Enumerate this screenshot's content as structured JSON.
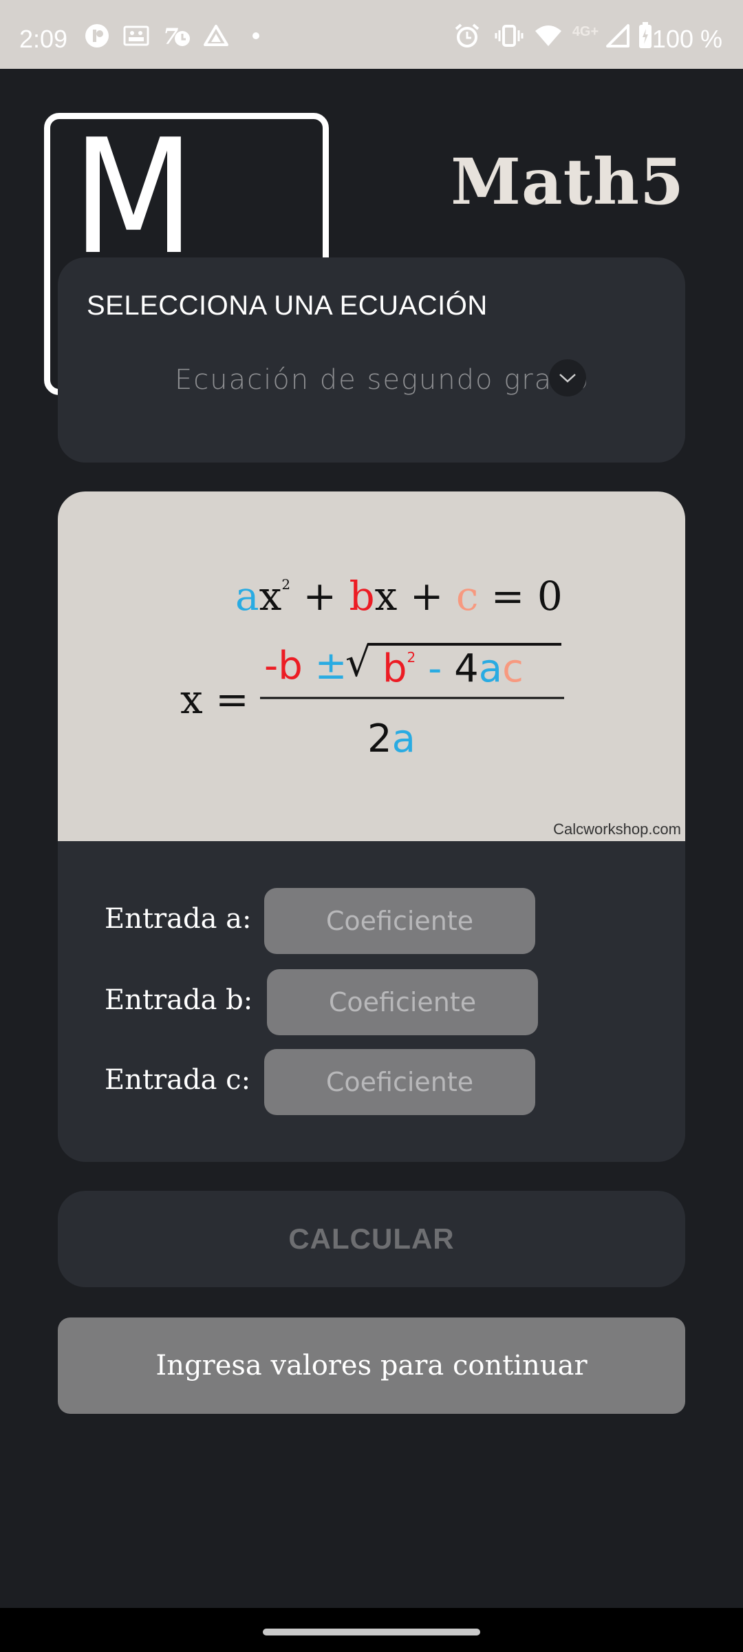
{
  "status_bar": {
    "time": "2:09",
    "network": "4G+",
    "battery": "100 %",
    "icons": [
      "app-icon-p",
      "gallery-icon",
      "lock-app-icon",
      "drive-icon",
      "dot-icon",
      "alarm-icon",
      "vibrate-icon",
      "wifi-icon",
      "signal-icon",
      "battery-charging-icon"
    ]
  },
  "app": {
    "logo_letter": "M",
    "title": "Math5"
  },
  "equation_select": {
    "heading": "SELECCIONA UNA ECUACIÓN",
    "value": "Ecuación de segundo grado"
  },
  "formula": {
    "credit": "Calcworkshop.com",
    "colors": {
      "a": "#29abe2",
      "b": "#ec1c24",
      "c": "#f7997f",
      "text": "#111111"
    }
  },
  "inputs": [
    {
      "label": "Entrada a:",
      "placeholder": "Coeficiente"
    },
    {
      "label": "Entrada b:",
      "placeholder": "Coeficiente"
    },
    {
      "label": "Entrada c:",
      "placeholder": "Coeficiente"
    }
  ],
  "calculate_button": "CALCULAR",
  "result_message": "Ingresa valores para continuar"
}
